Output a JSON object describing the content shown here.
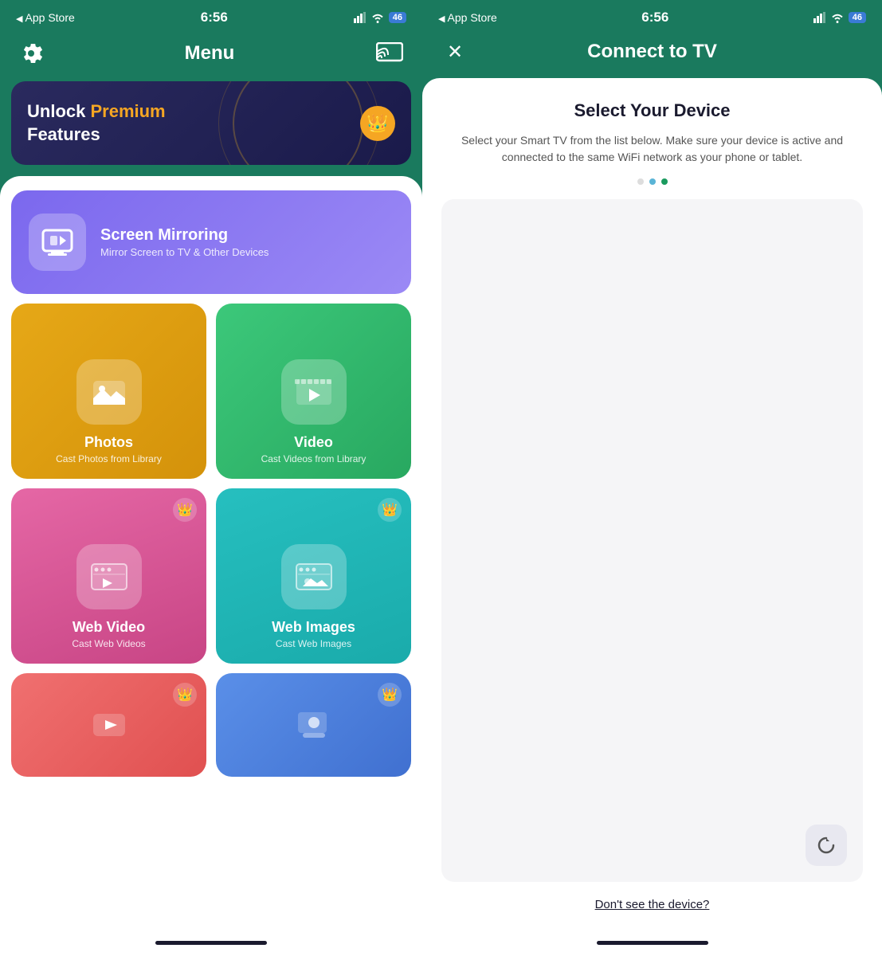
{
  "left": {
    "status": {
      "time": "6:56",
      "back_label": "App Store"
    },
    "header": {
      "title": "Menu"
    },
    "premium": {
      "line1": "Unlock ",
      "highlight": "Premium",
      "line2": "Features",
      "crown": "👑"
    },
    "menu_items": [
      {
        "id": "screen-mirroring",
        "title": "Screen Mirroring",
        "subtitle": "Mirror Screen to TV & Other Devices",
        "color": "purple",
        "full_width": true
      },
      {
        "id": "photos",
        "title": "Photos",
        "subtitle": "Cast Photos from Library",
        "color": "yellow",
        "premium": false
      },
      {
        "id": "video",
        "title": "Video",
        "subtitle": "Cast Videos from Library",
        "color": "green",
        "premium": false
      },
      {
        "id": "web-video",
        "title": "Web Video",
        "subtitle": "Cast Web Videos",
        "color": "pink",
        "premium": true
      },
      {
        "id": "web-images",
        "title": "Web Images",
        "subtitle": "Cast Web Images",
        "color": "teal",
        "premium": true
      }
    ],
    "home_bar_color": "#1a1a2e"
  },
  "right": {
    "status": {
      "time": "6:56",
      "back_label": "App Store"
    },
    "header": {
      "title": "Connect to TV",
      "close_label": "✕"
    },
    "modal": {
      "title": "Select Your Device",
      "description": "Select your Smart TV from the list below. Make sure your device is active and connected to the same WiFi network as your phone or tablet.",
      "dots": [
        "light",
        "blue",
        "green"
      ],
      "refresh_icon": "↻",
      "dont_see_label": "Don't see the device?"
    },
    "home_bar_color": "#1a1a2e"
  }
}
